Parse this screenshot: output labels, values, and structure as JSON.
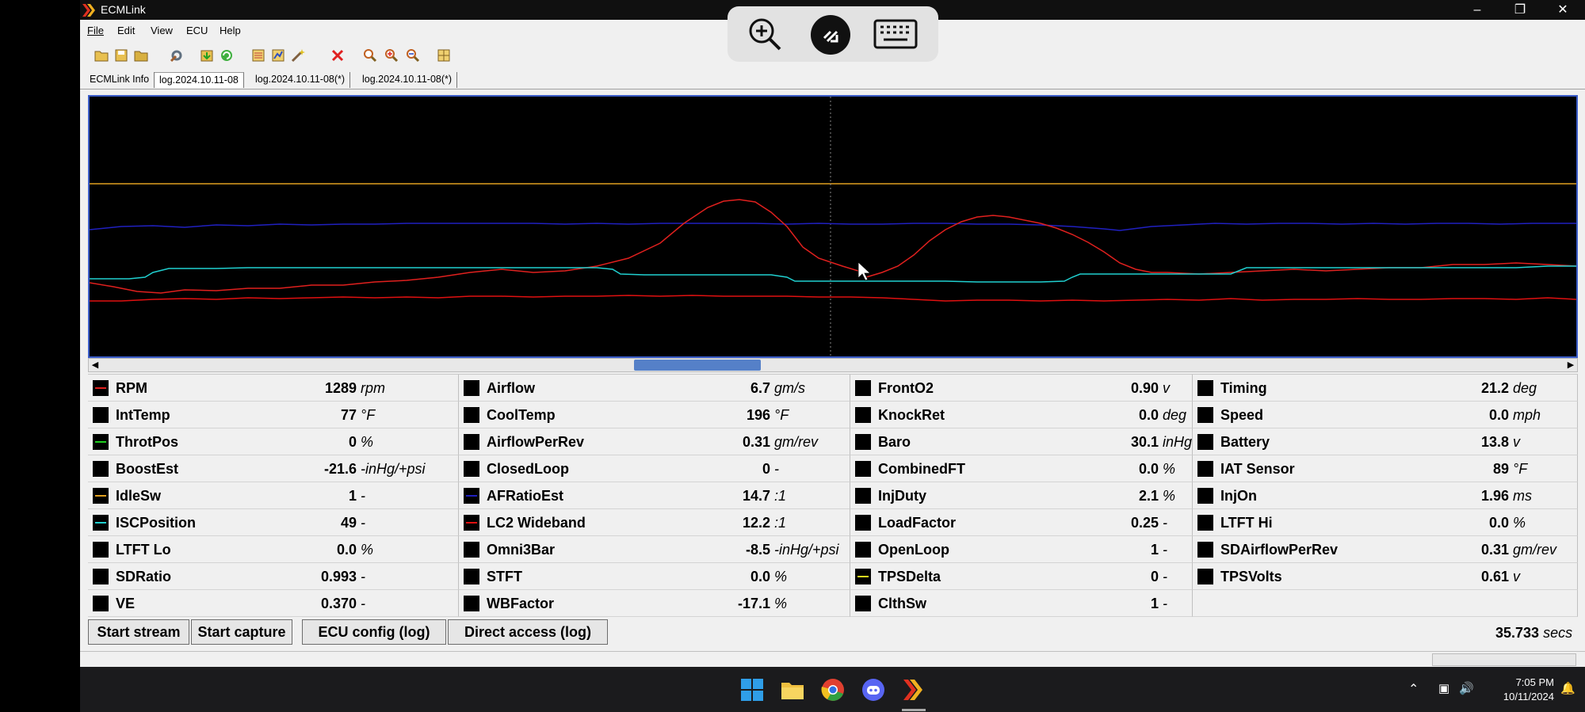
{
  "window": {
    "title": "ECMLink"
  },
  "menu": [
    "File",
    "Edit",
    "View",
    "ECU",
    "Help"
  ],
  "toolbar_icons": [
    "open-folder-icon",
    "save-icon",
    "folder-icon",
    "tools-icon",
    "load-icon",
    "refresh-icon",
    "config-icon",
    "map-icon",
    "wand-icon",
    "close-x-icon",
    "zoom-icon",
    "zoom-in-icon",
    "zoom-out-icon",
    "grid-icon"
  ],
  "tabs": [
    "ECMLink Info",
    "log.2024.10.11-08",
    "log.2024.10.11-08(*)",
    "log.2024.10.11-08(*)"
  ],
  "overlay_icons": [
    "zoom-in-icon",
    "remote-desktop-icon",
    "keyboard-icon"
  ],
  "colors": {
    "rpm": "#e0201e",
    "throttle": "#20d020",
    "idle": "#e0a020",
    "isc": "#20d0d0",
    "afr": "#2020c0",
    "lc2": "#e01010",
    "tpsdelta": "#e0e020",
    "scroll_thumb": "#5580c8",
    "chart_border": "#3a5cc8"
  },
  "parameters": [
    [
      {
        "name": "RPM",
        "value": "1289",
        "unit": "rpm",
        "color": "#e0201e"
      },
      {
        "name": "IntTemp",
        "value": "77",
        "unit": "°F",
        "color": ""
      },
      {
        "name": "ThrotPos",
        "value": "0",
        "unit": "%",
        "color": "#20d020"
      },
      {
        "name": "BoostEst",
        "value": "-21.6",
        "unit": "-inHg/+psi",
        "color": ""
      },
      {
        "name": "IdleSw",
        "value": "1",
        "unit": "-",
        "color": "#e0a020"
      },
      {
        "name": "ISCPosition",
        "value": "49",
        "unit": "-",
        "color": "#20d0d0"
      },
      {
        "name": "LTFT Lo",
        "value": "0.0",
        "unit": "%",
        "color": ""
      },
      {
        "name": "SDRatio",
        "value": "0.993",
        "unit": "-",
        "color": ""
      },
      {
        "name": "VE",
        "value": "0.370",
        "unit": "-",
        "color": ""
      }
    ],
    [
      {
        "name": "Airflow",
        "value": "6.7",
        "unit": "gm/s",
        "color": ""
      },
      {
        "name": "CoolTemp",
        "value": "196",
        "unit": "°F",
        "color": ""
      },
      {
        "name": "AirflowPerRev",
        "value": "0.31",
        "unit": "gm/rev",
        "color": ""
      },
      {
        "name": "ClosedLoop",
        "value": "0",
        "unit": "-",
        "color": ""
      },
      {
        "name": "AFRatioEst",
        "value": "14.7",
        "unit": ":1",
        "color": "#2020c0"
      },
      {
        "name": "LC2 Wideband",
        "value": "12.2",
        "unit": ":1",
        "color": "#e01010"
      },
      {
        "name": "Omni3Bar",
        "value": "-8.5",
        "unit": "-inHg/+psi",
        "color": ""
      },
      {
        "name": "STFT",
        "value": "0.0",
        "unit": "%",
        "color": ""
      },
      {
        "name": "WBFactor",
        "value": "-17.1",
        "unit": "%",
        "color": ""
      }
    ],
    [
      {
        "name": "FrontO2",
        "value": "0.90",
        "unit": "v",
        "color": ""
      },
      {
        "name": "KnockRet",
        "value": "0.0",
        "unit": "deg",
        "color": ""
      },
      {
        "name": "Baro",
        "value": "30.1",
        "unit": "inHg",
        "color": ""
      },
      {
        "name": "CombinedFT",
        "value": "0.0",
        "unit": "%",
        "color": ""
      },
      {
        "name": "InjDuty",
        "value": "2.1",
        "unit": "%",
        "color": ""
      },
      {
        "name": "LoadFactor",
        "value": "0.25",
        "unit": "-",
        "color": ""
      },
      {
        "name": "OpenLoop",
        "value": "1",
        "unit": "-",
        "color": ""
      },
      {
        "name": "TPSDelta",
        "value": "0",
        "unit": "-",
        "color": "#e0e020"
      },
      {
        "name": "ClthSw",
        "value": "1",
        "unit": "-",
        "color": ""
      }
    ],
    [
      {
        "name": "Timing",
        "value": "21.2",
        "unit": "deg",
        "color": ""
      },
      {
        "name": "Speed",
        "value": "0.0",
        "unit": "mph",
        "color": ""
      },
      {
        "name": "Battery",
        "value": "13.8",
        "unit": "v",
        "color": ""
      },
      {
        "name": "IAT Sensor",
        "value": "89",
        "unit": "°F",
        "color": ""
      },
      {
        "name": "InjOn",
        "value": "1.96",
        "unit": "ms",
        "color": ""
      },
      {
        "name": "LTFT Hi",
        "value": "0.0",
        "unit": "%",
        "color": ""
      },
      {
        "name": "SDAirflowPerRev",
        "value": "0.31",
        "unit": "gm/rev",
        "color": ""
      },
      {
        "name": "TPSVolts",
        "value": "0.61",
        "unit": "v",
        "color": ""
      },
      {
        "name": "",
        "value": "",
        "unit": "",
        "color": ""
      }
    ]
  ],
  "buttons": {
    "start_stream": "Start stream",
    "start_capture": "Start capture",
    "ecu_config": "ECU config (log)",
    "direct_access": "Direct access (log)"
  },
  "elapsed": {
    "value": "35.733",
    "unit": "secs"
  },
  "taskbar": {
    "apps": [
      "windows-start-icon",
      "file-explorer-icon",
      "chrome-icon",
      "discord-icon",
      "ecmlink-icon"
    ],
    "time": "7:05 PM",
    "date": "10/11/2024"
  }
}
